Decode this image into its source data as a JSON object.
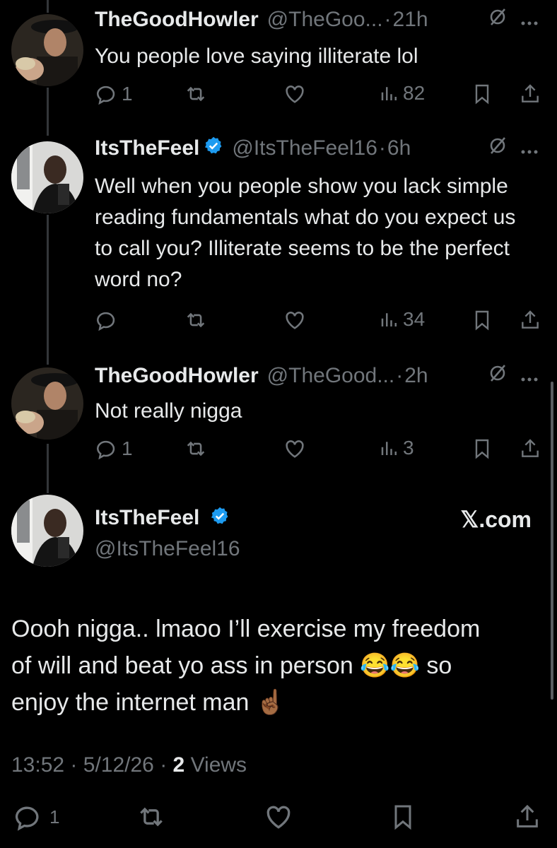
{
  "tweets": [
    {
      "name": "TheGoodHowler",
      "handle": "@TheGoo...",
      "time": "21h",
      "text": "You people love saying illiterate lol",
      "replies": "1",
      "views": "82",
      "verified": false
    },
    {
      "name": "ItsTheFeel",
      "handle": "@ItsTheFeel16",
      "time": "6h",
      "text": "Well when you people show you lack simple reading fundamentals what do you expect us to call you? Illiterate seems to be the perfect word no?",
      "replies": "",
      "views": "34",
      "verified": true
    },
    {
      "name": "TheGoodHowler",
      "handle": "@TheGood...",
      "time": "2h",
      "text": "Not really nigga",
      "replies": "1",
      "views": "3",
      "verified": false
    }
  ],
  "main": {
    "name": "ItsTheFeel",
    "handle": "@ItsTheFeel16",
    "watermark": "𝕏.com",
    "text_lines": [
      "Oooh nigga.. lmaoo I’ll exercise my freedom",
      "of will and beat yo ass in person 😂😂 so",
      "enjoy the internet man ☝🏾"
    ],
    "time": "13:52",
    "date": "5/12/26",
    "views_count": "2",
    "views_label": "Views",
    "replies": "1"
  },
  "separator": "·",
  "colors": {
    "background": "#000000",
    "text": "#e7e9ea",
    "muted": "#71767b",
    "verified": "#1d9bf0"
  },
  "icons": [
    "reply-icon",
    "retweet-icon",
    "like-icon",
    "views-icon",
    "bookmark-icon",
    "share-icon",
    "grok-icon",
    "more-icon",
    "verified-icon"
  ]
}
